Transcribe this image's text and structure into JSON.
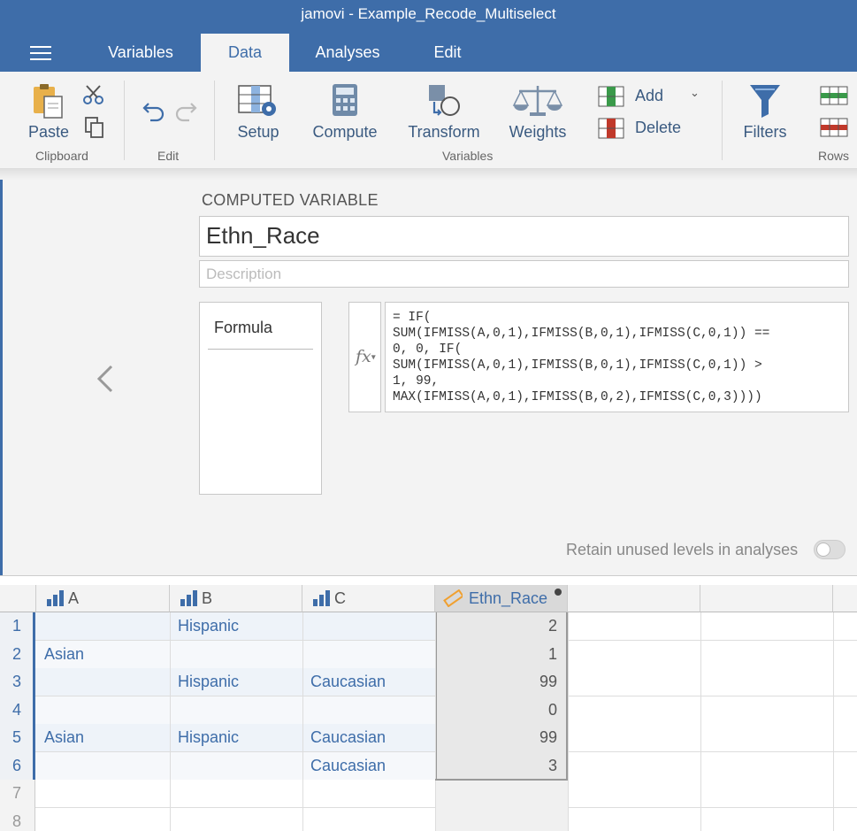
{
  "window": {
    "title": "jamovi - Example_Recode_Multiselect"
  },
  "menu": {
    "tabs": [
      "Variables",
      "Data",
      "Analyses",
      "Edit"
    ],
    "active": "Data"
  },
  "ribbon": {
    "paste": "Paste",
    "clipboard_group": "Clipboard",
    "edit_group": "Edit",
    "setup": "Setup",
    "compute": "Compute",
    "transform": "Transform",
    "weights": "Weights",
    "add": "Add",
    "delete": "Delete",
    "variables_group": "Variables",
    "filters": "Filters",
    "rows_group": "Rows"
  },
  "computed": {
    "heading": "COMPUTED VARIABLE",
    "name": "Ethn_Race",
    "description_placeholder": "Description",
    "formula_tab": "Formula",
    "fx_label": "fx",
    "formula_lines": [
      "= IF(",
      "SUM(IFMISS(A,0,1),IFMISS(B,0,1),IFMISS(C,0,1)) ==",
      "0, 0, IF(",
      "SUM(IFMISS(A,0,1),IFMISS(B,0,1),IFMISS(C,0,1)) >",
      "1, 99,",
      "MAX(IFMISS(A,0,1),IFMISS(B,0,2),IFMISS(C,0,3))))"
    ],
    "retain_label": "Retain unused levels in analyses",
    "retain_on": false
  },
  "sheet": {
    "columns": [
      "A",
      "B",
      "C",
      "Ethn_Race"
    ],
    "rows": [
      {
        "n": "1",
        "A": "",
        "B": "Hispanic",
        "C": "",
        "E": "2"
      },
      {
        "n": "2",
        "A": "Asian",
        "B": "",
        "C": "",
        "E": "1"
      },
      {
        "n": "3",
        "A": "",
        "B": "Hispanic",
        "C": "Caucasian",
        "E": "99"
      },
      {
        "n": "4",
        "A": "",
        "B": "",
        "C": "",
        "E": "0"
      },
      {
        "n": "5",
        "A": "Asian",
        "B": "Hispanic",
        "C": "Caucasian",
        "E": "99"
      },
      {
        "n": "6",
        "A": "",
        "B": "",
        "C": "Caucasian",
        "E": "3"
      }
    ],
    "empty_rows": [
      "7",
      "8"
    ]
  },
  "colors": {
    "accent": "#3e6da9",
    "computed_icon": "#f0a030"
  }
}
